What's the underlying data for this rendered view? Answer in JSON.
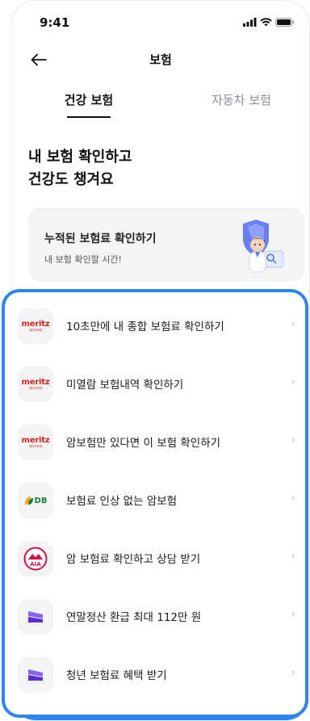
{
  "status_bar": {
    "time": "9:41",
    "signal_icon": "cellular-signal-icon",
    "wifi_icon": "wifi-icon",
    "battery_icon": "battery-icon"
  },
  "nav": {
    "title": "보험",
    "back_icon": "back-arrow-icon"
  },
  "tabs": [
    {
      "label": "건강 보험",
      "active": true
    },
    {
      "label": "자동차 보험",
      "active": false
    }
  ],
  "headline": {
    "line1": "내 보험 확인하고",
    "line2": "건강도 챙겨요"
  },
  "promo": {
    "title": "누적된 보험료 확인하기",
    "subtitle": "내 보험 확인할 시간!",
    "illustration": "doctor-shield-icon"
  },
  "list": {
    "items": [
      {
        "label": "10초만에 내 종합 보험료 확인하기",
        "icon": "meritz-logo"
      },
      {
        "label": "미열람 보험내역 확인하기",
        "icon": "meritz-logo"
      },
      {
        "label": "암보험만 있다면 이 보험 확인하기",
        "icon": "meritz-logo"
      },
      {
        "label": "보험료 인상 없는 암보험",
        "icon": "db-logo"
      },
      {
        "label": "암 보험료 확인하고 상담 받기",
        "icon": "aia-logo"
      },
      {
        "label": "연말정산 환급 최대 112만 원",
        "icon": "purple-arrow-logo"
      },
      {
        "label": "청년 보험료 혜택 받기",
        "icon": "purple-arrow-logo"
      }
    ],
    "chevron_icon": "chevron-right-icon"
  },
  "logos": {
    "meritz": {
      "word": "meritz",
      "sub": "메리츠화재"
    },
    "db": {
      "word": "DB"
    },
    "aia": {
      "word": "AIA"
    }
  },
  "colors": {
    "accent": "#2f84f3",
    "meritz_red": "#d0231c",
    "db_green": "#1d7f3f",
    "aia_red": "#d31145",
    "purple": "#6b3fe0"
  }
}
